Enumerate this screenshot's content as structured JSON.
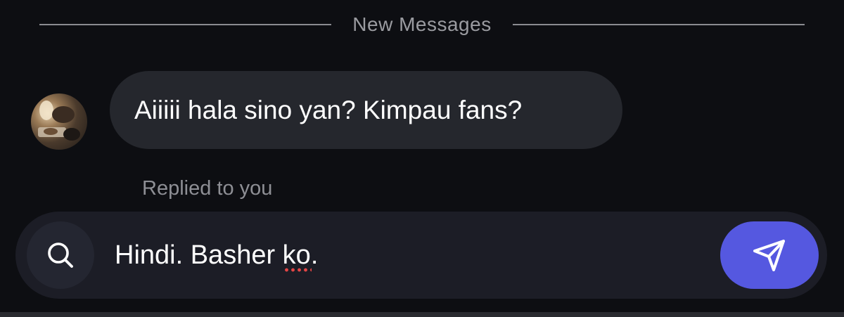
{
  "divider": {
    "label": "New Messages"
  },
  "message": {
    "text": "Aiiiii hala sino yan? Kimpau fans?",
    "avatar_icon": "user-avatar-photo"
  },
  "reply": {
    "label": "Replied to you"
  },
  "composer": {
    "text_before": "Hindi. Basher ",
    "misspelled": "ko",
    "text_after": ".",
    "left_icon": "search-icon",
    "send_icon": "send-icon"
  },
  "colors": {
    "background": "#0d0e12",
    "bubble": "#25272d",
    "composer": "#1c1d26",
    "send_button": "#5558e0",
    "spellcheck": "#e34545"
  }
}
